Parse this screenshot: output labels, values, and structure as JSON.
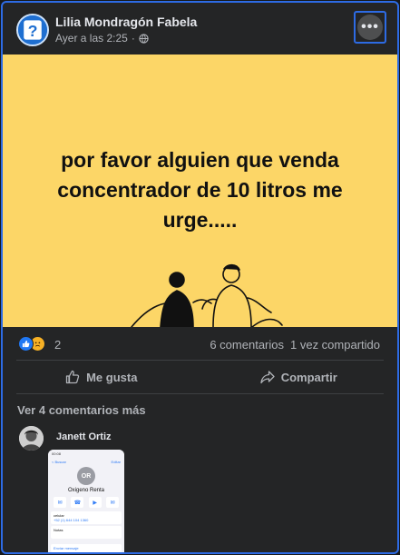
{
  "post": {
    "author": "Lilia Mondragón Fabela",
    "timestamp": "Ayer a las 2:25",
    "separator": "·",
    "privacy_icon": "globe-icon",
    "more_icon": "•••",
    "image_text": "por favor alguien que venda concentrador de 10 litros me urge.....",
    "image_bg_color": "#fcd667"
  },
  "reactions": {
    "icons": [
      "like-icon",
      "sad-icon"
    ],
    "count": "2",
    "comments": "6 comentarios",
    "shares": "1 vez compartido"
  },
  "actions": {
    "like_label": "Me gusta",
    "share_label": "Compartir"
  },
  "comments": {
    "more_label": "Ver 4 comentarios más",
    "first_author": "Janett Ortiz",
    "attachment": {
      "initials": "OR",
      "name": "Oxigeno Renta",
      "status_time": "00:08",
      "back": "< Buscar",
      "edit": "Editar",
      "field1_label": "celular",
      "field1_value": "+52 (1) 644 104 1360",
      "field2_label": "Notas",
      "link_label": "Enviar mensaje"
    }
  },
  "colors": {
    "accent": "#2d6be4",
    "background": "#242526",
    "like": "#2078f4"
  }
}
